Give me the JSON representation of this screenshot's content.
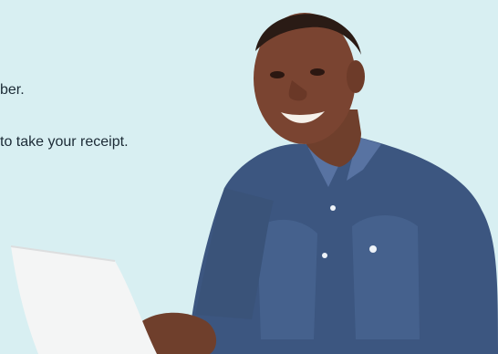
{
  "banner": {
    "text_lines": [
      "ber.",
      "to take your receipt."
    ],
    "background_color": "#d8eff2",
    "image_subject": "smiling man in denim shirt using a laptop"
  }
}
